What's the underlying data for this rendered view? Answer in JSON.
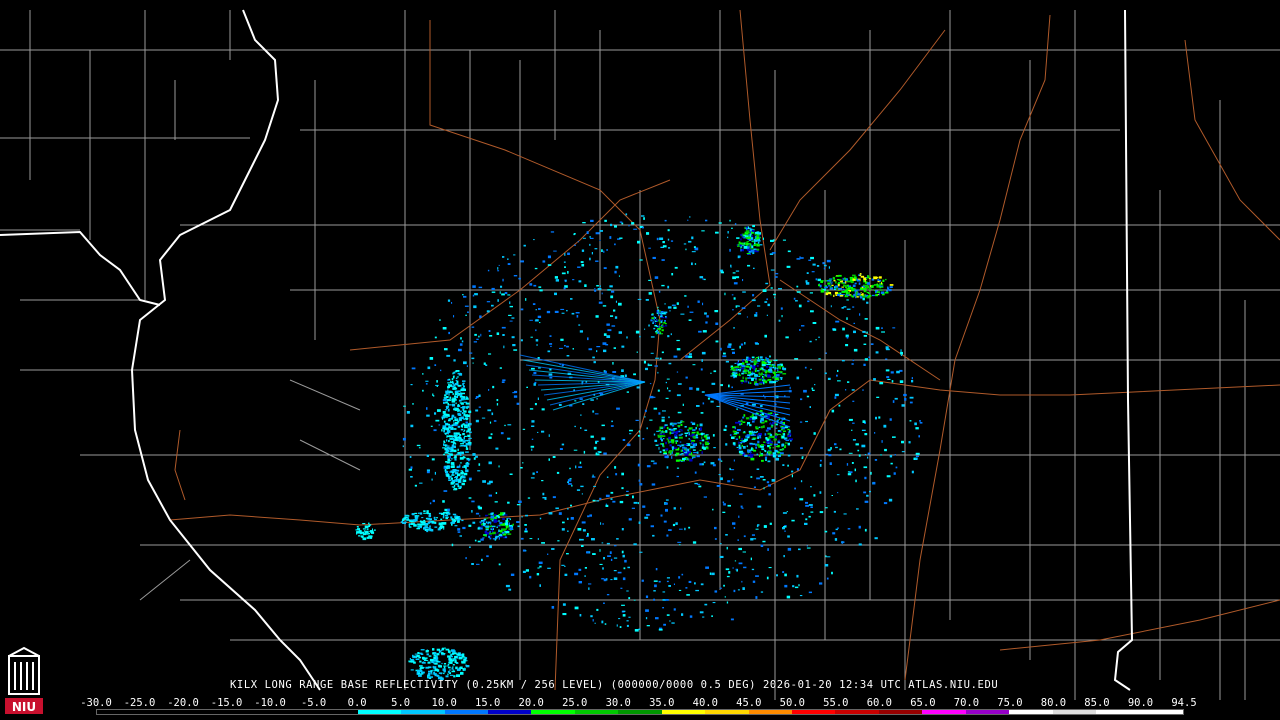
{
  "product": {
    "caption": "KILX LONG RANGE BASE REFLECTIVITY (0.25KM / 256 LEVEL) (000000/0000 0.5 DEG) 2026-01-20 12:34 UTC  ATLAS.NIU.EDU"
  },
  "legend": {
    "unit_labels": [
      "-30.0",
      "-25.0",
      "-20.0",
      "-15.0",
      "-10.0",
      "-5.0",
      "0.0",
      "5.0",
      "10.0",
      "15.0",
      "20.0",
      "25.0",
      "30.0",
      "35.0",
      "40.0",
      "45.0",
      "50.0",
      "55.0",
      "60.0",
      "65.0",
      "70.0",
      "75.0",
      "80.0",
      "85.0",
      "90.0",
      "94.5"
    ],
    "colors": [
      "#000000",
      "#000000",
      "#000000",
      "#000000",
      "#000000",
      "#000000",
      "#00ffff",
      "#00c8ff",
      "#0078ff",
      "#0000c8",
      "#00ff00",
      "#00c800",
      "#009600",
      "#ffff00",
      "#ffd700",
      "#ff8c00",
      "#ff0000",
      "#c80000",
      "#960000",
      "#ff00ff",
      "#9600c8",
      "#ffffff",
      "#dddddd",
      "#ffffff",
      "#ffffff"
    ]
  },
  "logo": {
    "text": "NIU"
  },
  "map": {
    "radar_site": "KILX",
    "state_border_color": "#ffffff",
    "county_border_color": "#a0a0a0",
    "highway_color": "#b05a2a"
  }
}
